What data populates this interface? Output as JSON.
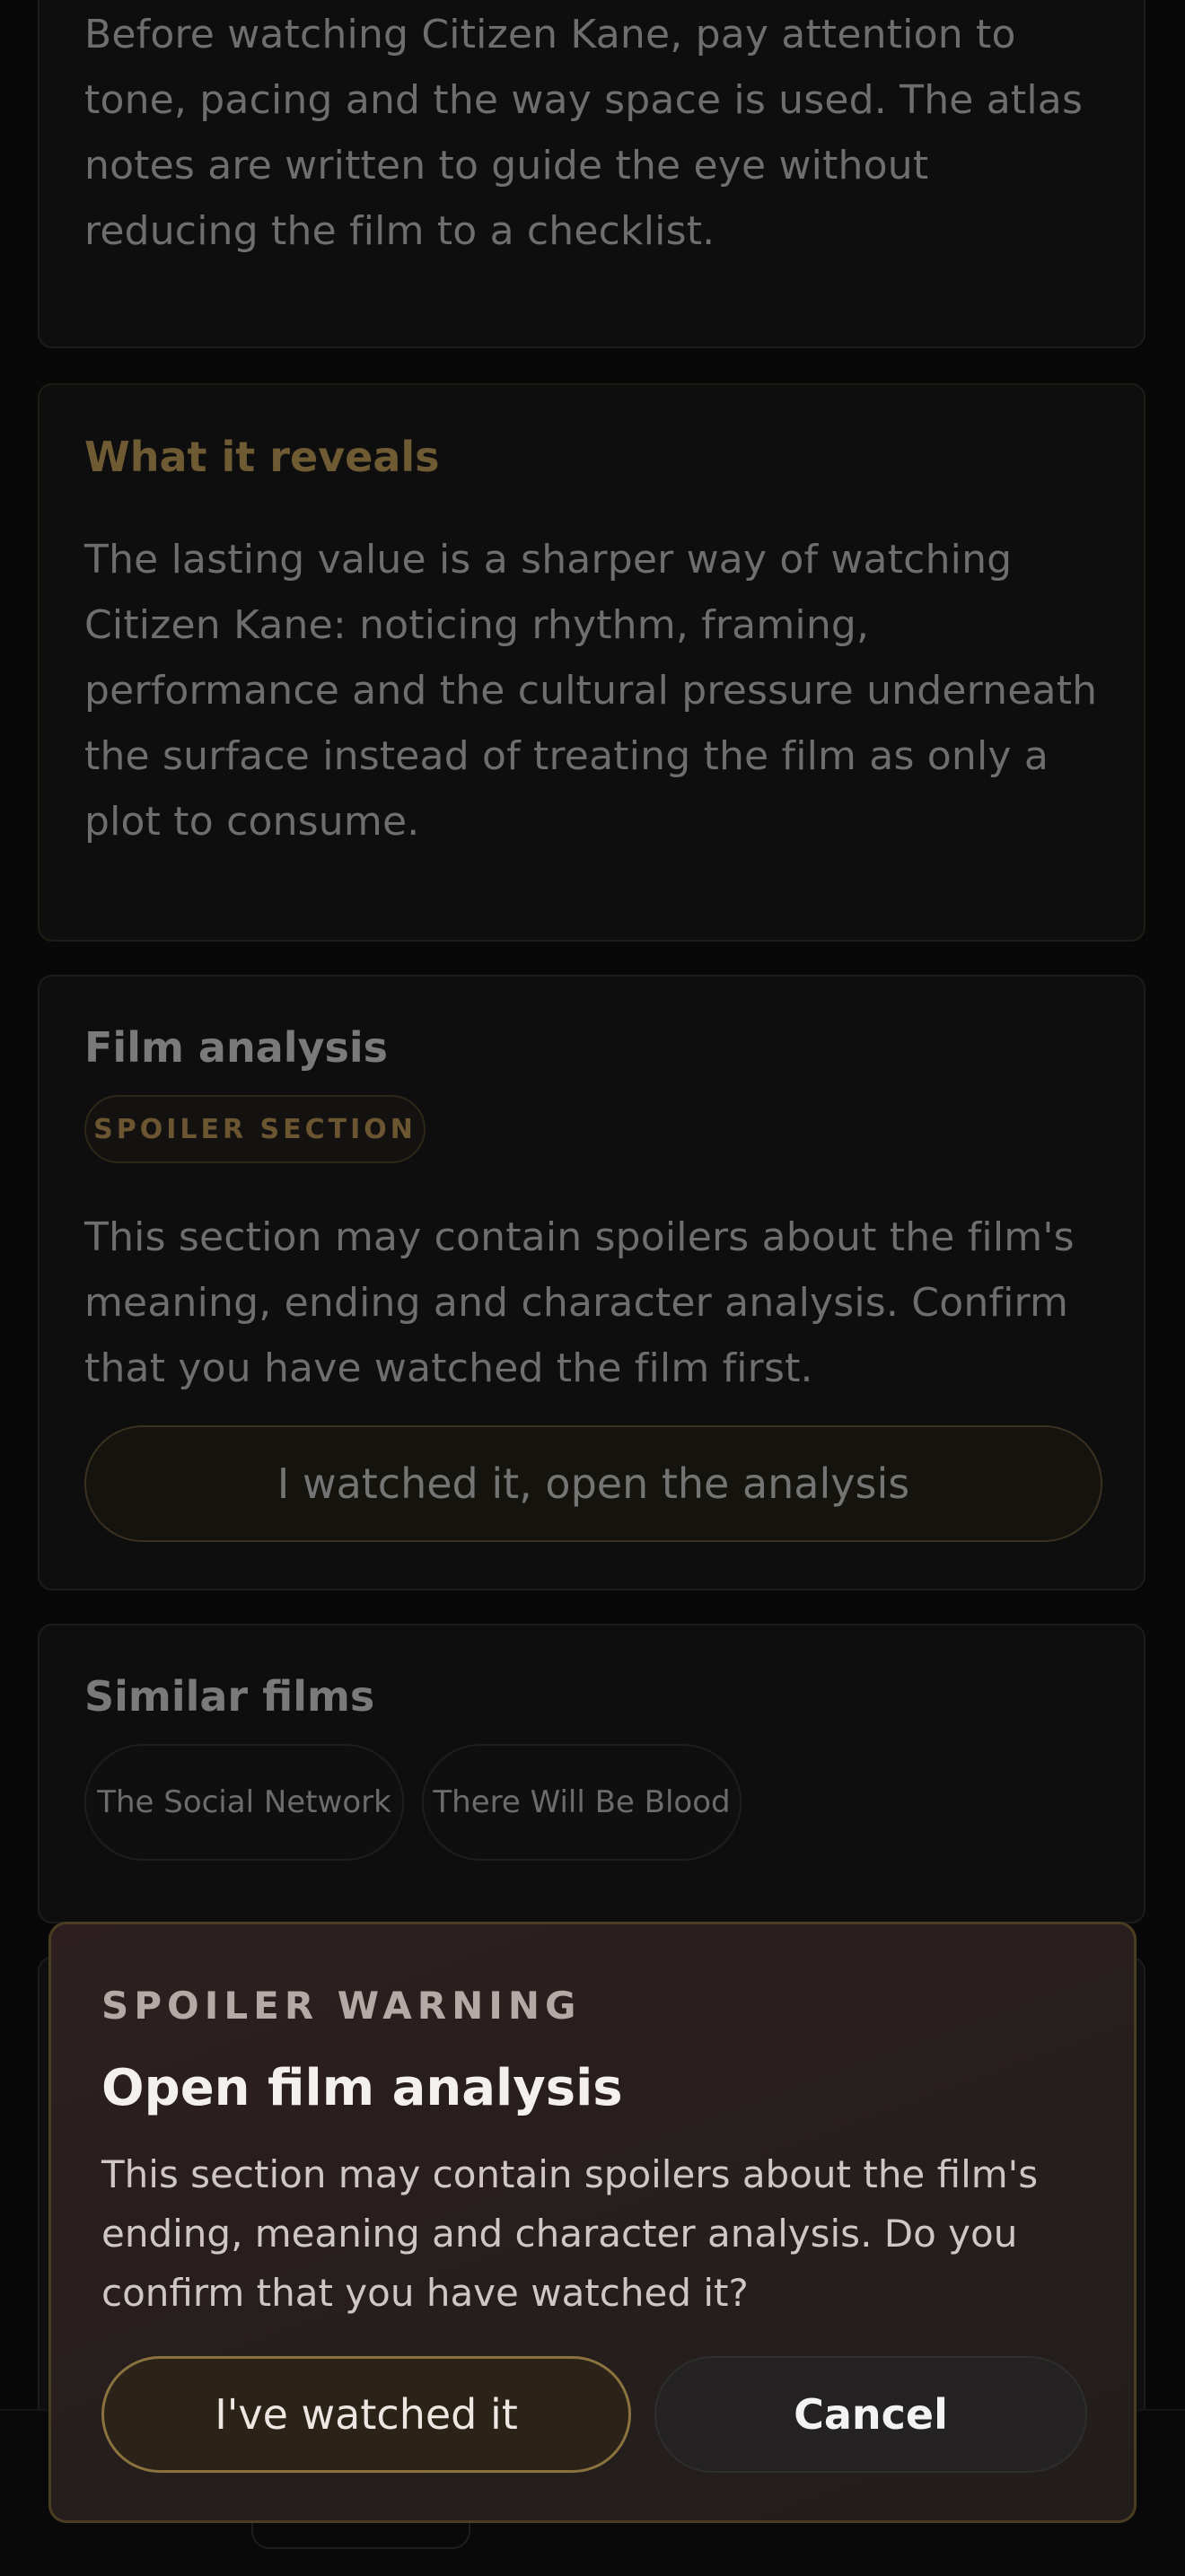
{
  "intro": {
    "text": "Before watching Citizen Kane, pay attention to tone, pacing and the way space is used. The atlas notes are written to guide the eye without reducing the film to a checklist."
  },
  "reveals": {
    "title": "What it reveals",
    "text": "The lasting value is a sharper way of watching Citizen Kane: noticing rhythm, framing, performance and the cultural pressure underneath the surface instead of treating the film as only a plot to consume."
  },
  "analysis": {
    "title": "Film analysis",
    "badge": "SPOILER SECTION",
    "text": "This section may contain spoilers about the film's meaning, ending and character analysis. Confirm that you have watched the film first.",
    "button_label": "I watched it, open the analysis"
  },
  "similar": {
    "title": "Similar films",
    "films": [
      "The Social Network",
      "There Will Be Blood"
    ]
  },
  "modal": {
    "eyebrow": "SPOILER WARNING",
    "title": "Open film analysis",
    "text": "This section may contain spoilers about the film's ending, meaning and character analysis. Do you confirm that you have watched it?",
    "confirm_label": "I've watched it",
    "cancel_label": "Cancel"
  },
  "colors": {
    "accent_gold": "#8a733f",
    "modal_background": "#2a1f1f",
    "page_background": "#080808"
  }
}
